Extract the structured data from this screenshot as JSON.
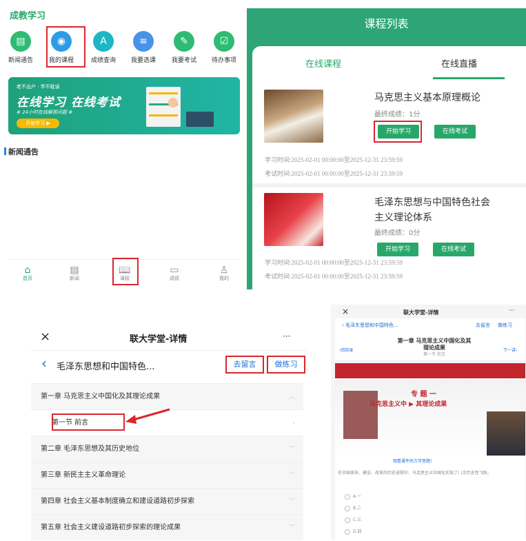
{
  "home": {
    "brand": "成教学习",
    "icons": [
      {
        "label": "新闻通告",
        "color": "#2fbb73",
        "glyph": "▤"
      },
      {
        "label": "我的课程",
        "color": "#2e9be6",
        "glyph": "◉"
      },
      {
        "label": "成绩查询",
        "color": "#1fb6c4",
        "glyph": "A"
      },
      {
        "label": "我要选课",
        "color": "#4a92e8",
        "glyph": "≡"
      },
      {
        "label": "我要考试",
        "color": "#2fbb73",
        "glyph": "✎"
      },
      {
        "label": "待办事项",
        "color": "#2fbb73",
        "glyph": "☑"
      }
    ],
    "banner": {
      "tag": "老不出户 · 学不耽误",
      "title": "在线学习  在线考试",
      "sub": "# 24小时在线解答问题 #",
      "btn": "开始学习 ▶"
    },
    "news_title": "新闻通告",
    "tabs": [
      {
        "label": "首页",
        "glyph": "⌂"
      },
      {
        "label": "新闻",
        "glyph": "▤"
      },
      {
        "label": "课程",
        "glyph": "📖"
      },
      {
        "label": "成绩",
        "glyph": "▭"
      },
      {
        "label": "我的",
        "glyph": "♙"
      }
    ]
  },
  "list": {
    "title": "课程列表",
    "tab_online": "在线课程",
    "tab_live": "在线直播",
    "courses": [
      {
        "title": "马克思主义基本原理概论",
        "score": "最终成绩：1分",
        "study": "开始学习",
        "exam": "在线考试",
        "study_time": "学习时间:2025-02-01 00:00:00至2025-12-31 23:59:59",
        "exam_time": "考试时间:2025-02-01 00:00:00至2025-12-31 23:59:59"
      },
      {
        "title1": "毛泽东思想与中国特色社会",
        "title2": "主义理论体系",
        "score": "最终成绩：0分",
        "study": "开始学习",
        "exam": "在线考试",
        "study_time": "学习时间:2025-02-01 00:00:00至2025-12-31 23:59:59",
        "exam_time": "考试时间:2025-02-01 00:00:00至2025-12-31 23:59:59"
      }
    ]
  },
  "detail": {
    "title": "联大学堂-详情",
    "close": "×",
    "more": "···",
    "back": "‹",
    "course": "毛泽东思想和中国特色...",
    "msg": "去留言",
    "practice": "做练习",
    "chapters": [
      "第一章 马克思主义中国化及其理论成果",
      "第一节 前言",
      "第二章 毛泽东思想及其历史地位",
      "第三章 新民主主义革命理论",
      "第四章 社会主义基本制度确立和建设道路初步探索",
      "第五章 社会主义建设道路初步探索的理论成果"
    ]
  },
  "player": {
    "title": "联大学堂-详情",
    "close": "×",
    "more": "···",
    "course": "毛泽东思想和中国特色...",
    "msg": "去留言",
    "practice": "做练习",
    "h1": "第一章 马克思主义中国化及其",
    "h2": "理论成果",
    "sub": "第一节 前言",
    "prev": "‹回目录",
    "next": "下一讲›",
    "vt1": "专 题 一",
    "vt2": "马克思主义中 ▶ 其理论成果",
    "hint": "观看课件后方可答题!",
    "q": "在中国革命、建设、改革的历史进程中，马克思主义中国化实现了( )次历史性飞跃。",
    "opts": [
      "A.一",
      "B.二",
      "C.三",
      "D.四"
    ]
  }
}
